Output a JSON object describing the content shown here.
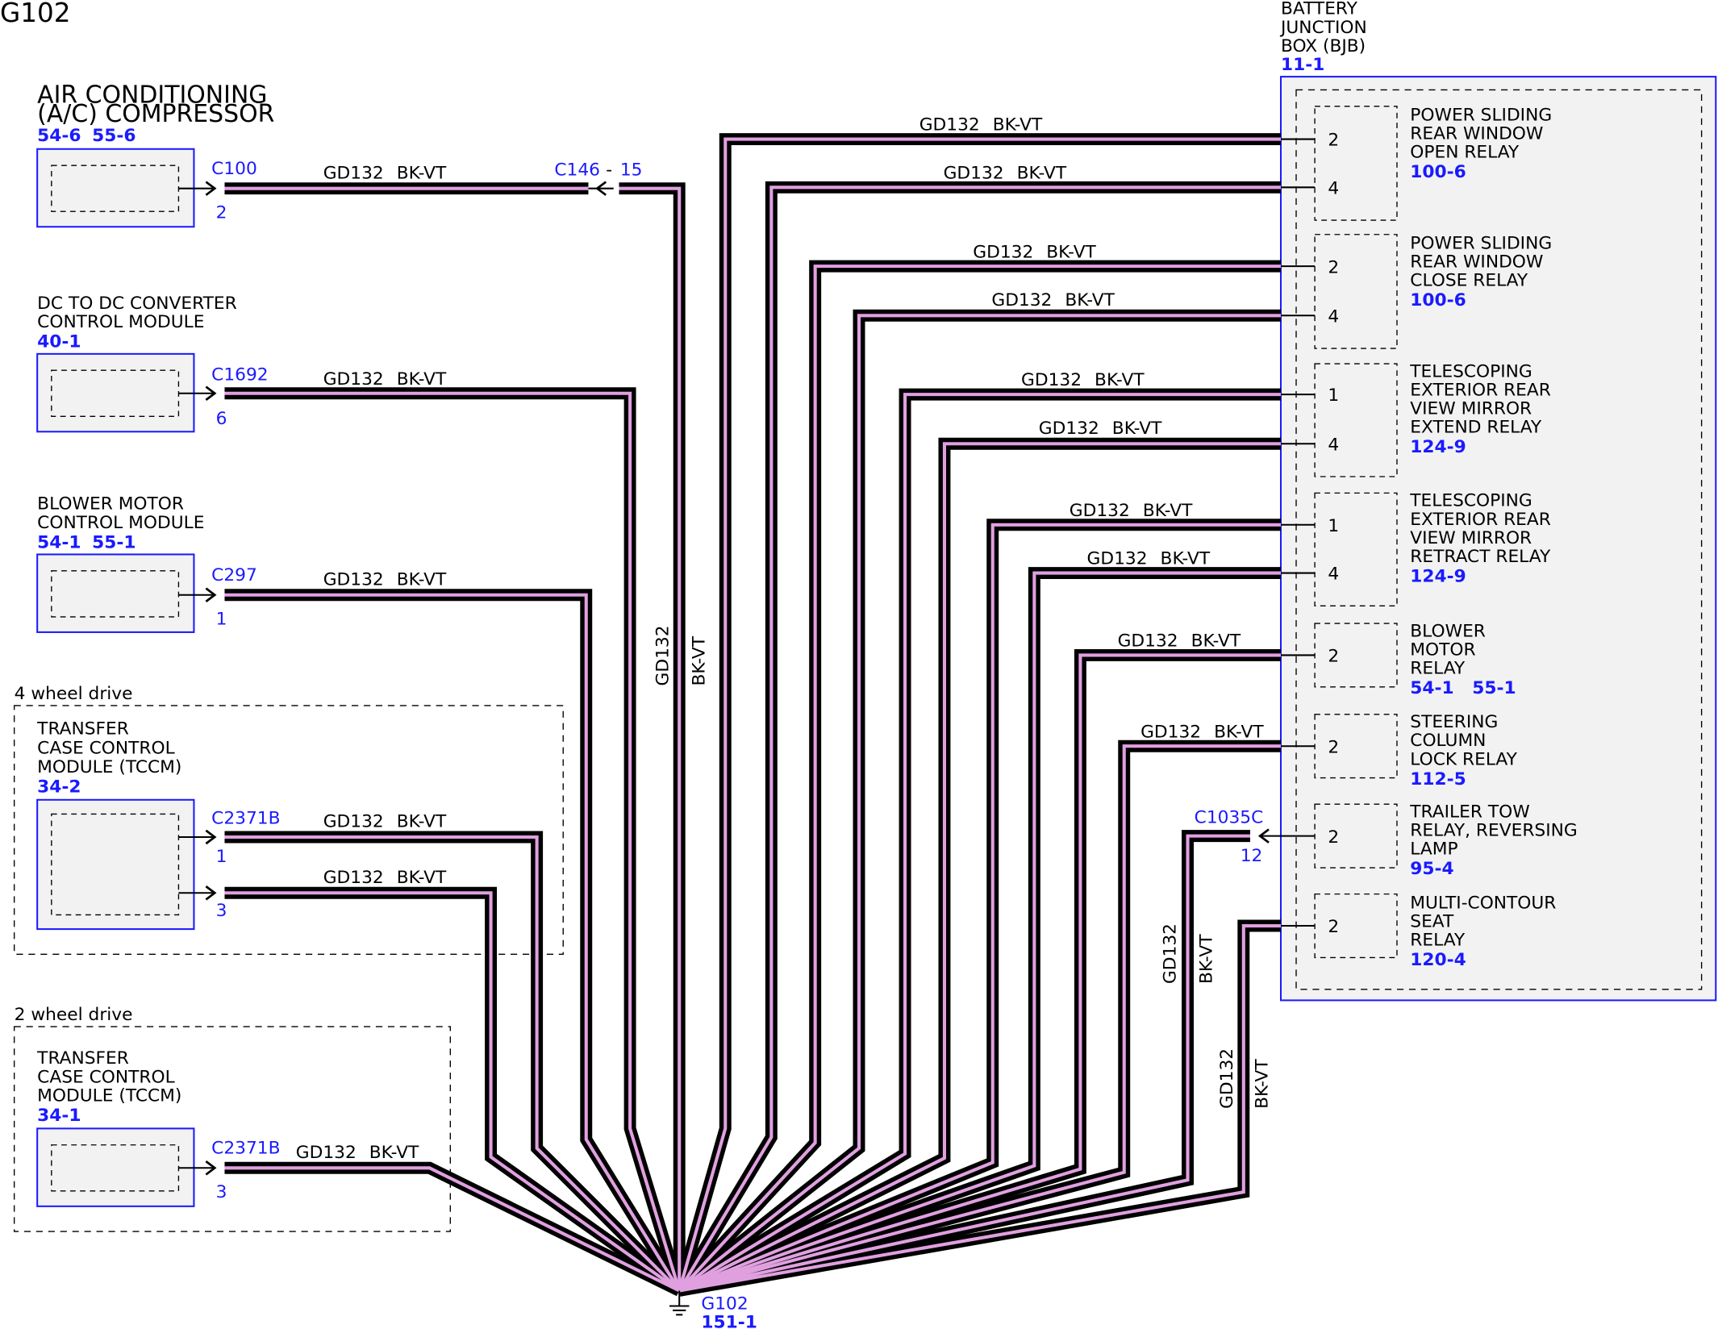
{
  "title": "G102",
  "wire_circuit": "GD132",
  "wire_color": "BK-VT",
  "ground": {
    "label": "G102",
    "ref": "151-1"
  },
  "components": [
    {
      "id": "ac",
      "name": [
        "AIR CONDITIONING",
        "(A/C) COMPRESSOR"
      ],
      "refs": [
        "54-6",
        "55-6"
      ],
      "connector": "C100",
      "pin": "2"
    },
    {
      "id": "dcdc",
      "name": [
        "DC TO DC CONVERTER",
        "CONTROL MODULE"
      ],
      "refs": [
        "40-1"
      ],
      "connector": "C1692",
      "pin": "6"
    },
    {
      "id": "blower",
      "name": [
        "BLOWER MOTOR",
        "CONTROL MODULE"
      ],
      "refs": [
        "54-1",
        "55-1"
      ],
      "connector": "C297",
      "pin": "1"
    },
    {
      "id": "tccm4",
      "group": "4 wheel drive",
      "name": [
        "TRANSFER",
        "CASE CONTROL",
        "MODULE (TCCM)"
      ],
      "refs": [
        "34-2"
      ],
      "connector": "C2371B",
      "pins": [
        "1",
        "3"
      ]
    },
    {
      "id": "tccm2",
      "group": "2 wheel drive",
      "name": [
        "TRANSFER",
        "CASE CONTROL",
        "MODULE (TCCM)"
      ],
      "refs": [
        "34-1"
      ],
      "connector": "C2371B",
      "pin": "3"
    }
  ],
  "inline_connector": {
    "label": "C146",
    "separator": "-",
    "pin": "15"
  },
  "bjb": {
    "name": [
      "BATTERY",
      "JUNCTION",
      "BOX (BJB)"
    ],
    "ref": "11-1",
    "relays": [
      {
        "name": [
          "POWER SLIDING",
          "REAR WINDOW",
          "OPEN RELAY"
        ],
        "ref": "100-6",
        "pins": [
          "2",
          "4"
        ]
      },
      {
        "name": [
          "POWER SLIDING",
          "REAR WINDOW",
          "CLOSE RELAY"
        ],
        "ref": "100-6",
        "pins": [
          "2",
          "4"
        ]
      },
      {
        "name": [
          "TELESCOPING",
          "EXTERIOR REAR",
          "VIEW MIRROR",
          "EXTEND RELAY"
        ],
        "ref": "124-9",
        "pins": [
          "1",
          "4"
        ]
      },
      {
        "name": [
          "TELESCOPING",
          "EXTERIOR REAR",
          "VIEW MIRROR",
          "RETRACT RELAY"
        ],
        "ref": "124-9",
        "pins": [
          "1",
          "4"
        ]
      },
      {
        "name": [
          "BLOWER",
          "MOTOR",
          "RELAY"
        ],
        "ref": "54-1   55-1",
        "pins": [
          "2"
        ]
      },
      {
        "name": [
          "STEERING",
          "COLUMN",
          "LOCK RELAY"
        ],
        "ref": "112-5",
        "pins": [
          "2"
        ]
      },
      {
        "name": [
          "TRAILER TOW",
          "RELAY, REVERSING",
          "LAMP"
        ],
        "ref": "95-4",
        "pins": [
          "2"
        ]
      },
      {
        "name": [
          "MULTI-CONTOUR",
          "SEAT",
          "RELAY"
        ],
        "ref": "120-4",
        "pins": [
          "2"
        ]
      }
    ],
    "connector": {
      "label": "C1035C",
      "pin": "12"
    }
  }
}
